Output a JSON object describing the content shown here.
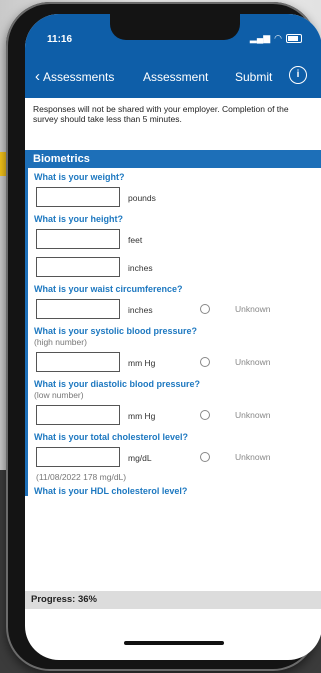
{
  "status": {
    "time": "11:16"
  },
  "nav": {
    "back_label": "Assessments",
    "title": "Assessment",
    "submit_label": "Submit",
    "info_symbol": "i"
  },
  "intro_text": "Responses will not be shared with your employer. Completion of the survey should take less than 5 minutes.",
  "section_title": "Biometrics",
  "unknown_label": "Unknown",
  "questions": {
    "weight": {
      "title": "What is your weight?",
      "unit": "pounds",
      "value": ""
    },
    "height": {
      "title": "What is your height?",
      "unit_feet": "feet",
      "unit_inches": "inches",
      "value_feet": "",
      "value_inches": ""
    },
    "waist": {
      "title": "What is your waist circumference?",
      "unit": "inches",
      "value": ""
    },
    "systolic": {
      "title": "What is your systolic blood pressure?",
      "subtitle": "(high number)",
      "unit": "mm Hg",
      "value": ""
    },
    "diastolic": {
      "title": "What is your diastolic blood pressure?",
      "subtitle": "(low number)",
      "unit": "mm Hg",
      "value": ""
    },
    "cholesterol": {
      "title": "What is your total cholesterol level?",
      "unit": "mg/dL",
      "value": "",
      "previous": "(11/08/2022  178 mg/dL)"
    },
    "hdl": {
      "title": "What is your HDL cholesterol level?"
    }
  },
  "progress": {
    "label": "Progress: 36%",
    "percent": 36
  }
}
